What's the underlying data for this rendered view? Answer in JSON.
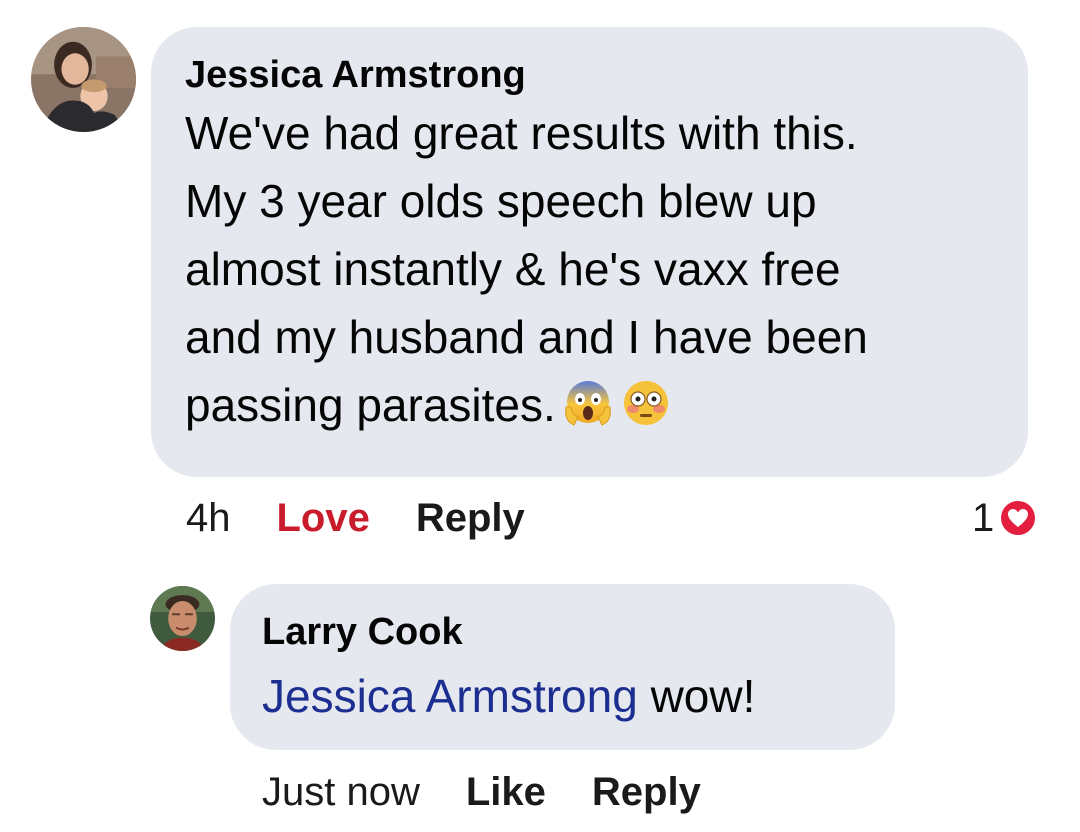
{
  "comment": {
    "author": "Jessica Armstrong",
    "text_lines": [
      "We've had great results with this.",
      "My 3 year olds speech blew up",
      "almost instantly & he's vaxx free",
      "and my husband and I have been",
      "passing parasites."
    ],
    "emojis": [
      "face-screaming-in-fear-icon",
      "flushed-face-icon"
    ],
    "time": "4h",
    "reaction_label": "Love",
    "reply_label": "Reply",
    "reaction_count": "1",
    "reaction_type": "love-heart-icon",
    "colors": {
      "love": "#c81b2b",
      "bubble": "#e5e8ef"
    }
  },
  "reply": {
    "author": "Larry Cook",
    "mention": "Jessica Armstrong",
    "text": " wow!",
    "time": "Just now",
    "like_label": "Like",
    "reply_label": "Reply",
    "colors": {
      "mention": "#1d2e91"
    }
  }
}
